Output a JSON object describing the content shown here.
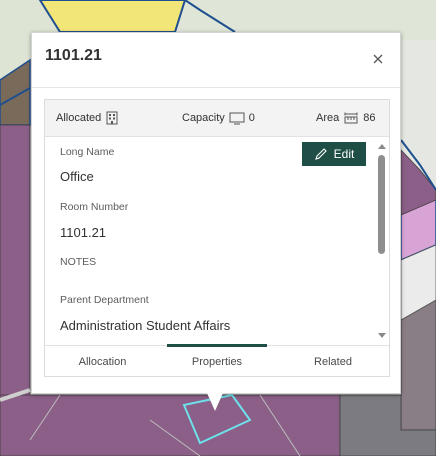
{
  "popup": {
    "title": "1101.21",
    "close_icon": "close-icon"
  },
  "stats": {
    "allocated_label": "Allocated",
    "allocated_icon": "building-icon",
    "capacity_label": "Capacity",
    "capacity_icon": "monitor-icon",
    "capacity_value": "0",
    "area_label": "Area",
    "area_icon": "area-measure-icon",
    "area_value": "86"
  },
  "edit_button": {
    "label": "Edit",
    "icon": "pencil-icon"
  },
  "fields": [
    {
      "label": "Long Name",
      "value": "Office"
    },
    {
      "label": "Room Number",
      "value": "1101.21"
    },
    {
      "label": "NOTES",
      "value": ""
    },
    {
      "label": "Parent Department",
      "value": "Administration Student Affairs"
    }
  ],
  "tabs": [
    {
      "label": "Allocation",
      "active": false
    },
    {
      "label": "Properties",
      "active": true
    },
    {
      "label": "Related",
      "active": false
    }
  ],
  "colors": {
    "accent": "#1f4e46",
    "room_purple": "#8b5f87",
    "room_yellow": "#f2e678",
    "room_brown": "#7a6a59",
    "room_gray": "#8a7e86",
    "room_pink": "#d8a4d6",
    "room_outline": "#1f4f8f",
    "selection": "#6ee0ec"
  }
}
